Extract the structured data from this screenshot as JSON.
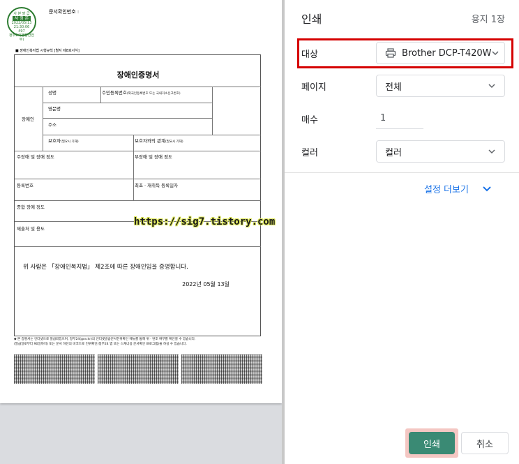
{
  "preview": {
    "seal": {
      "top": "사 본 발 급",
      "mid": "사 정 본",
      "date": "2022/05/13",
      "time": "21:30:06",
      "serial": "497",
      "bottom": "정부24(행정안전부)"
    },
    "doc_number_label": "문서확인번호 :",
    "reg_note": "■ 장애인복지법 시행규칙 [별지 제8호서식]",
    "title": "장애인증명서",
    "cells": {
      "applicant": "장애인",
      "name": "성명",
      "rrn": "주민등록번호",
      "rrn_note": "(외국인등록번호 또는 국내거소신고번호)",
      "english_name": "영문명",
      "address": "주소",
      "guardian": "보호자",
      "guardian_note": "(필요시 기재)",
      "guardian_rel": "보호자와의 관계",
      "guardian_rel_note": "(필요시 기재)",
      "main_disability": "주장애 및 장애 정도",
      "sub_disability": "부장애 및 장애 정도",
      "reg_number": "등록번호",
      "reg_date": "최초 · 재취득 등록일자",
      "total_degree": "종합 장애 정도",
      "submit_purpose": "제출처 및 용도"
    },
    "cert_text": "위 사람은 「장애인복지법」 제2조에 따른 장애인임을 증명합니다.",
    "cert_date": "2022년 05월 13일",
    "footnote_1": "◆ 본 증명서는 인터넷으로 발급되었으며, 정부24(gov.kr)의 인터넷발급문서진위확인 메뉴를 통해 위 · 변조 여부를 확인할 수 있습니다.",
    "footnote_2": "(발급일로부터 90일까지) 또는 문서 하단의 바코드로 진위확인(정부24 앱 또는 스캐너용 문서확인 프로그램)을 하실 수 있습니다.",
    "watermark": "https://sig7.tistory.com"
  },
  "panel": {
    "title": "인쇄",
    "paper_count": "용지 1장",
    "destination": {
      "label": "대상",
      "value": "Brother DCP-T420W"
    },
    "pages": {
      "label": "페이지",
      "value": "전체"
    },
    "copies": {
      "label": "매수",
      "value": "1"
    },
    "color": {
      "label": "컬러",
      "value": "컬러"
    },
    "more_settings": "설정 더보기",
    "print_button": "인쇄",
    "cancel_button": "취소"
  },
  "colors": {
    "accent": "#1a73e8",
    "print_button": "#3a8a74",
    "highlight": "#d50000"
  }
}
